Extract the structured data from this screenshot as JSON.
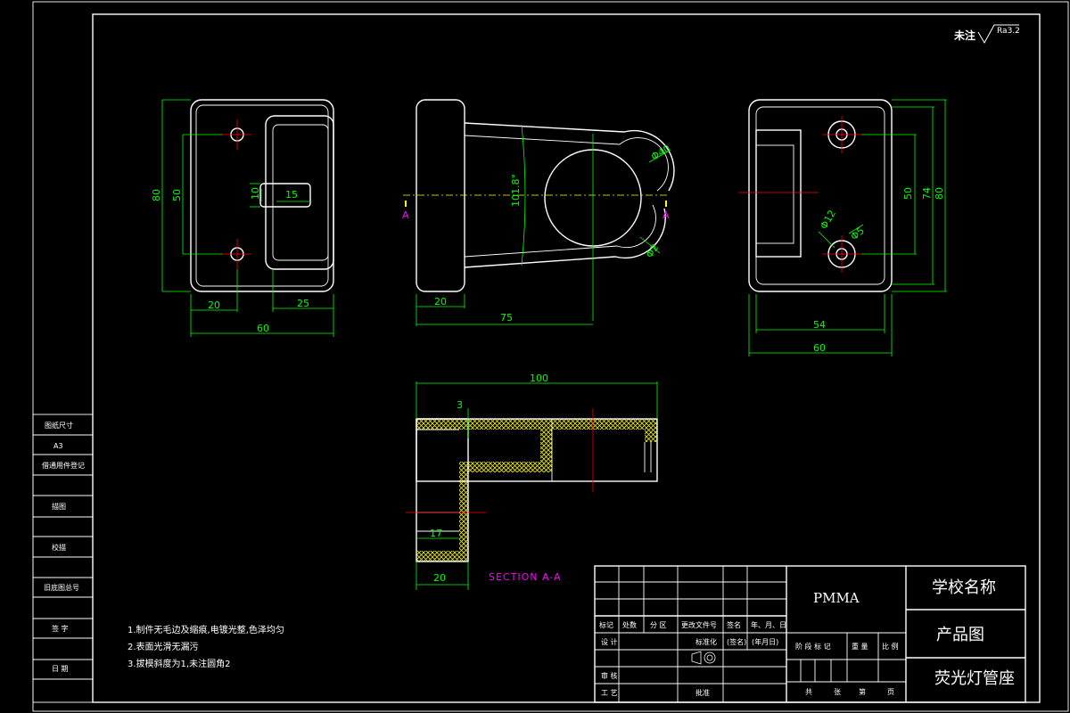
{
  "drawing": {
    "surface_note": "未注",
    "roughness": "Ra3.2",
    "section_label": "SECTION A-A",
    "section_letter": "A",
    "views": {
      "front": {
        "dims": [
          "80",
          "50",
          "10",
          "15",
          "20",
          "25",
          "60"
        ]
      },
      "side": {
        "dims": [
          "101.8°",
          "Φ40",
          "Φ2",
          "20",
          "75"
        ]
      },
      "right": {
        "dims": [
          "Φ12",
          "Φ5",
          "50",
          "74",
          "80",
          "54",
          "60"
        ]
      },
      "section": {
        "dims": [
          "100",
          "3",
          "17",
          "20"
        ]
      }
    },
    "notes": [
      "1.制件无毛边及缩痕,电镀光整,色泽均匀",
      "2.表面光滑无漏污",
      "3.拔模斜度为1,未注圆角2"
    ]
  },
  "side_panel": [
    "图纸尺寸",
    "A3",
    "借通用件登记",
    "旧底图总号",
    "描图",
    "校描",
    "签 字",
    "日 期"
  ],
  "title_block": {
    "material": "PMMA",
    "school": "学校名称",
    "drawing_type": "产品图",
    "part_name": "荧光灯管座",
    "headers": [
      "标记",
      "处数",
      "分 区",
      "更改文件号",
      "签名",
      "年、月、日"
    ],
    "row_design": [
      "设 计",
      "标准化",
      "(签名)",
      "(年月日)"
    ],
    "stage_headers": [
      "阶 段 标 记",
      "重 量",
      "比 例"
    ],
    "row_review": "审 核",
    "row_process": "工 艺",
    "row_approve": "批准",
    "sheet": [
      "共",
      "张",
      "第",
      "页"
    ]
  }
}
